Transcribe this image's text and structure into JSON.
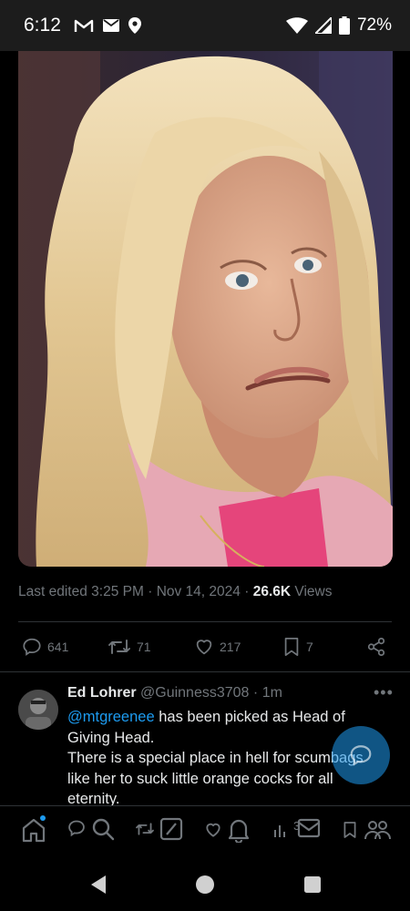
{
  "status_bar": {
    "time": "6:12",
    "battery": "72%",
    "left_icons": [
      "gmail-icon",
      "mail-icon",
      "location-icon"
    ],
    "right_icons": [
      "wifi-icon",
      "signal-icon",
      "battery-icon"
    ]
  },
  "tweet": {
    "image_alt": "Photo of a woman with long blonde hair",
    "meta": {
      "edited_prefix": "Last edited",
      "time": "3:25 PM",
      "date": "Nov 14, 2024",
      "views_count": "26.6K",
      "views_label": "Views"
    },
    "stats": {
      "replies": "641",
      "reposts": "71",
      "likes": "217",
      "bookmarks": "7"
    }
  },
  "reply": {
    "name": "Ed Lohrer",
    "handle": "@Guinness3708",
    "time": "1m",
    "mention": "@mtgreenee",
    "text_after_mention": " has been picked as Head of Giving Head.",
    "text_line2": "There is a special place in hell for scumbags like her to suck little orange cocks for all eternity."
  },
  "bottom_nav": {
    "items": [
      "home",
      "search",
      "grok",
      "notifications",
      "communities",
      "messages",
      "profile"
    ],
    "badge_value": "3"
  },
  "colors": {
    "accent": "#1d9bf0",
    "muted": "#71767b",
    "text": "#e7e9ea",
    "background": "#000000"
  }
}
